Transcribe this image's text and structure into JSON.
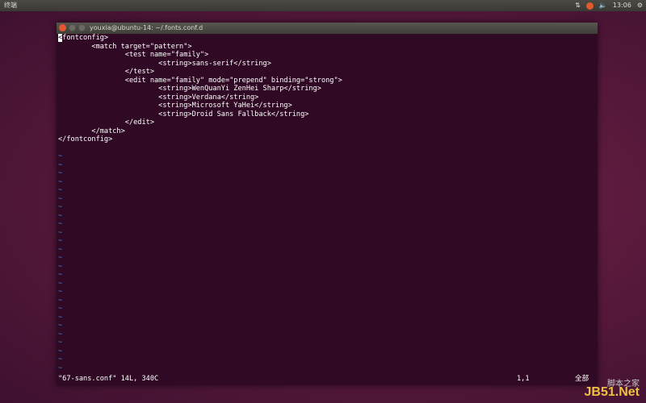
{
  "topbar": {
    "app_name": "终端",
    "clock": "13:06",
    "icons": [
      "network-icon",
      "notification-icon",
      "volume-icon",
      "settings-icon"
    ]
  },
  "window": {
    "title": "youxia@ubuntu-14: ~/.fonts.conf.d",
    "buttons": [
      "close",
      "minimize",
      "maximize"
    ]
  },
  "editor": {
    "cursor_char": "<",
    "lines": [
      "fontconfig>",
      "        <match target=\"pattern\">",
      "                <test name=\"family\">",
      "                        <string>sans-serif</string>",
      "                </test>",
      "                <edit name=\"family\" mode=\"prepend\" binding=\"strong\">",
      "                        <string>WenQuanYi ZenHei Sharp</string>",
      "                        <string>Verdana</string>",
      "                        <string>Microsoft YaHei</string>",
      "                        <string>Droid Sans Fallback</string>",
      "                </edit>",
      "        </match>",
      "</fontconfig>",
      ""
    ],
    "empty_marker": "~",
    "empty_line_count": 26,
    "status_file": "\"67-sans.conf\" 14L, 340C",
    "status_position": "1,1",
    "status_percent": "全部"
  },
  "watermark": {
    "text": "JB51.Net",
    "subtext": "脚本之家"
  }
}
